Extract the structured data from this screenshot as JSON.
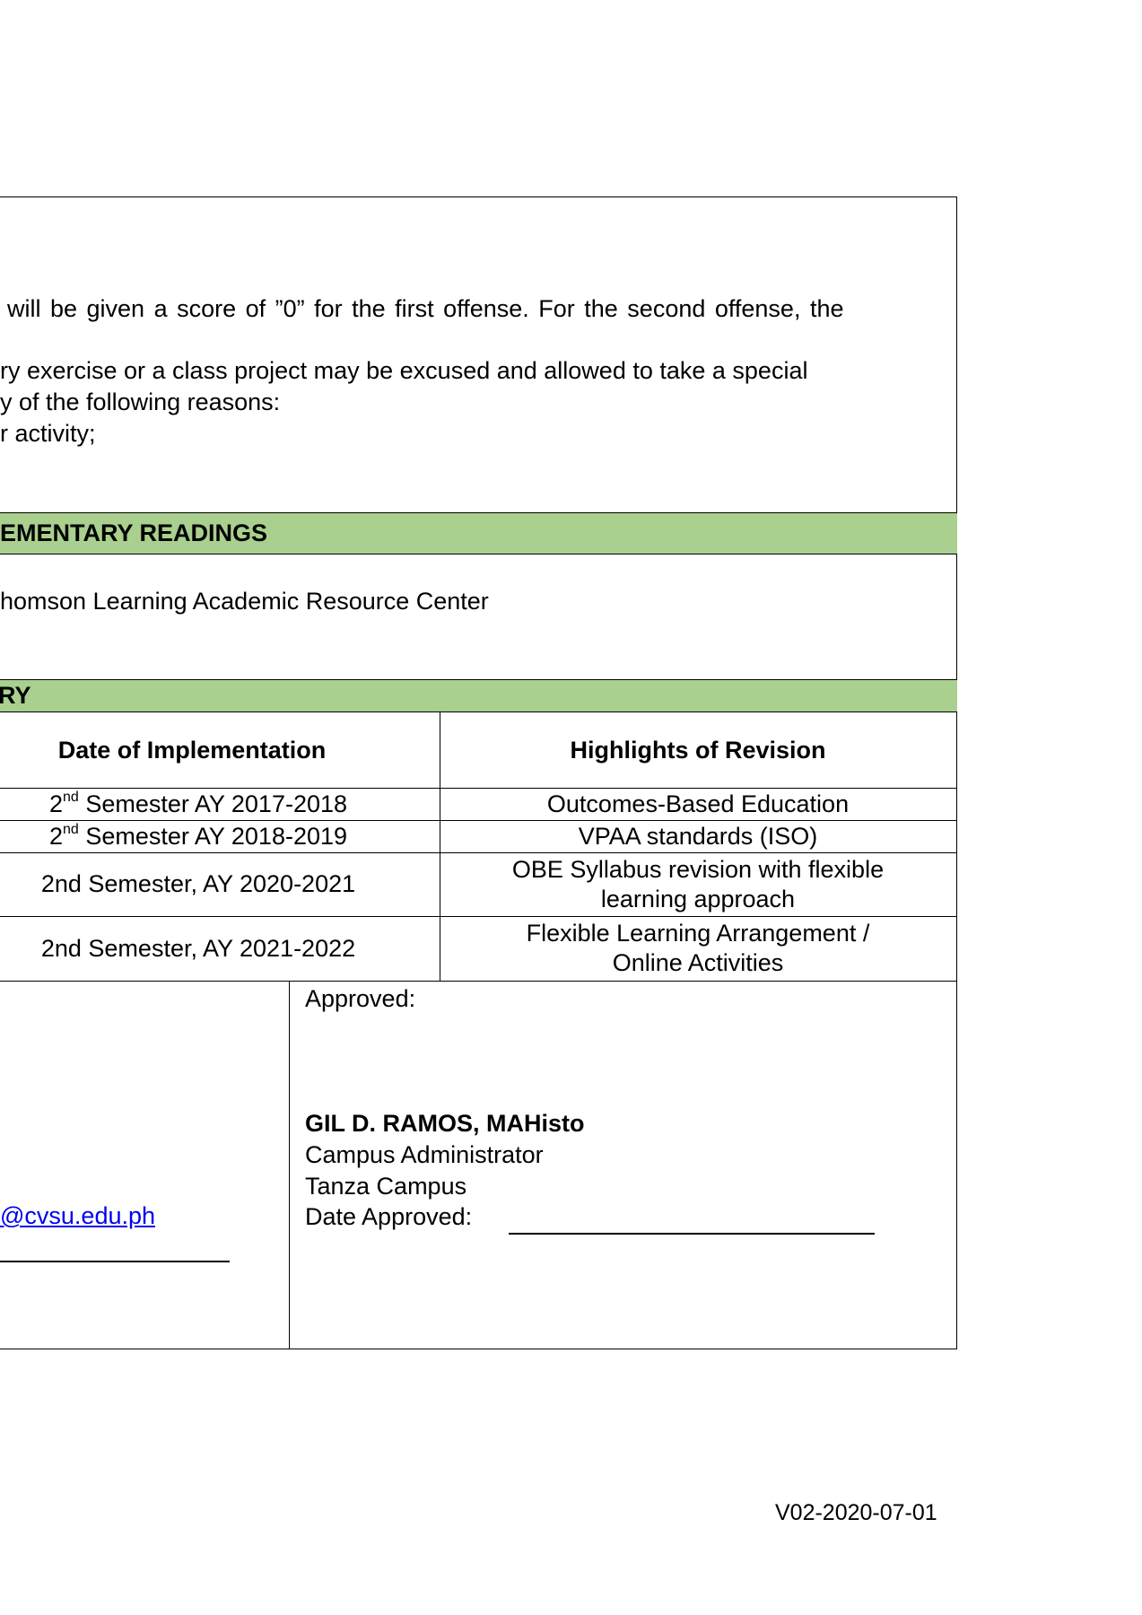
{
  "policies": {
    "line1": "will be given a score of ”0” for the first offense. For the second offense, the",
    "line2": "ry exercise or a class project may be excused and allowed to take a special",
    "line3": "y of the following reasons:",
    "line4": "r activity;"
  },
  "supplementary": {
    "header": "EMENTARY READINGS",
    "item": "homson Learning Academic Resource Center"
  },
  "revision_history": {
    "header": "RY",
    "col_date": "Date of Implementation",
    "col_highlights": "Highlights of Revision",
    "rows": [
      {
        "date_num": "2",
        "date_sup": "nd",
        "date_rest": " Semester AY 2017-2018",
        "highlights": [
          "Outcomes-Based Education"
        ]
      },
      {
        "date_num": "2",
        "date_sup": "nd",
        "date_rest": " Semester AY 2018-2019",
        "highlights": [
          "VPAA standards (ISO)"
        ]
      },
      {
        "date_num": "",
        "date_sup": "",
        "date_rest": "2nd Semester, AY 2020-2021",
        "highlights": [
          "OBE Syllabus revision with flexible",
          "learning approach"
        ]
      },
      {
        "date_num": "",
        "date_sup": "",
        "date_rest": "2nd Semester, AY 2021-2022",
        "highlights": [
          "Flexible Learning Arrangement /",
          "Online Activities"
        ]
      }
    ]
  },
  "signatures": {
    "email_fragment": "@cvsu.edu.ph",
    "approved_label": "Approved:",
    "approver_name": "GIL D. RAMOS, MAHisto",
    "approver_title": "Campus Administrator",
    "approver_campus": "Tanza Campus",
    "date_approved_label": "Date Approved:"
  },
  "footer": {
    "version": "V02-2020-07-01"
  },
  "colors": {
    "section_header_bg": "#a9d08e",
    "link": "#0000ee"
  }
}
